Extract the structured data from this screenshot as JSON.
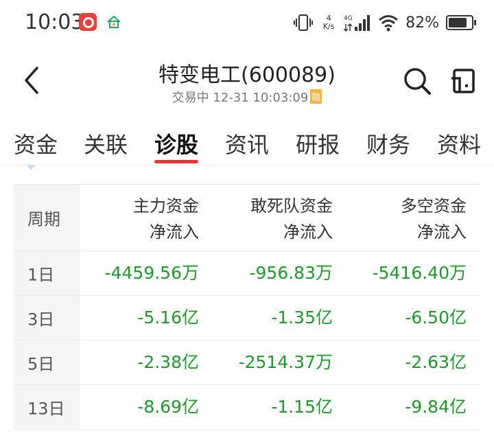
{
  "status_bar": {
    "time": "10:03",
    "net_speed_value": "4",
    "net_speed_unit": "K/s",
    "network_type": "4G",
    "battery_percent": "82%"
  },
  "header": {
    "title": "特变电工(600089)",
    "subtitle": "交易中 12-31 10:03:09",
    "badge": "融"
  },
  "tabs": [
    {
      "label": "资金",
      "active": false
    },
    {
      "label": "关联",
      "active": false
    },
    {
      "label": "诊股",
      "active": true
    },
    {
      "label": "资讯",
      "active": false
    },
    {
      "label": "研报",
      "active": false
    },
    {
      "label": "财务",
      "active": false
    },
    {
      "label": "资料",
      "active": false
    }
  ],
  "table": {
    "period_header": "周期",
    "columns": [
      {
        "line1": "主力资金",
        "line2": "净流入"
      },
      {
        "line1": "敢死队资金",
        "line2": "净流入"
      },
      {
        "line1": "多空资金",
        "line2": "净流入"
      }
    ],
    "rows": [
      {
        "period": "1日",
        "values": [
          "-4459.56万",
          "-956.83万",
          "-5416.40万"
        ]
      },
      {
        "period": "3日",
        "values": [
          "-5.16亿",
          "-1.35亿",
          "-6.50亿"
        ]
      },
      {
        "period": "5日",
        "values": [
          "-2.38亿",
          "-2514.37万",
          "-2.63亿"
        ]
      },
      {
        "period": "13日",
        "values": [
          "-8.69亿",
          "-1.15亿",
          "-9.84亿"
        ]
      }
    ]
  },
  "colors": {
    "negative": "#1f9a2a",
    "tab_indicator": "#e33333",
    "badge_bg": "#f3b33d"
  }
}
